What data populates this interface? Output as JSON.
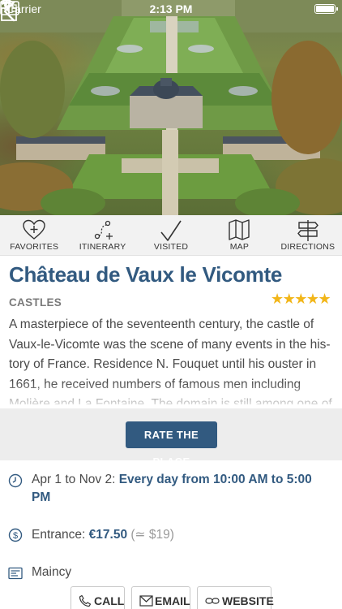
{
  "status": {
    "carrier": "Carrier",
    "time": "2:13 PM"
  },
  "nav": {
    "back_icon": "chevron-left-icon",
    "ticket_icon": "ticket-icon",
    "share_icon": "share-icon"
  },
  "actions": [
    {
      "label": "FAVORITES",
      "icon": "heart-plus-icon"
    },
    {
      "label": "ITINERARY",
      "icon": "route-plus-icon"
    },
    {
      "label": "VISITED",
      "icon": "checkmark-icon"
    },
    {
      "label": "MAP",
      "icon": "map-icon"
    },
    {
      "label": "DIRECTIONS",
      "icon": "signpost-icon"
    }
  ],
  "place": {
    "title": "Château de Vaux le Vicomte",
    "category": "CASTLES",
    "rating": 4.5,
    "stars_text": "★★★★★",
    "description": "A masterpiece of the seventeenth century, the castle of Vaux-le-Vicomte was the scene of many events in the his-tory of France. Residence N. Fouquet until his ouster in 1661, he received numbers of famous men including Molière and La Fontaine. The domain is still among one of"
  },
  "rate_button": "RATE THE PLACE",
  "hours": {
    "period": "Apr 1 to Nov 2: ",
    "schedule": "Every day from 10:00 AM to 5:00 PM"
  },
  "entrance": {
    "label": "Entrance: ",
    "price": "€17.50",
    "approx": " (≃ $19)"
  },
  "address": "Maincy",
  "contact": {
    "call": "CALL",
    "email": "EMAIL",
    "website": "WEBSITE"
  },
  "colors": {
    "accent": "#325a80",
    "star": "#f2b619"
  }
}
